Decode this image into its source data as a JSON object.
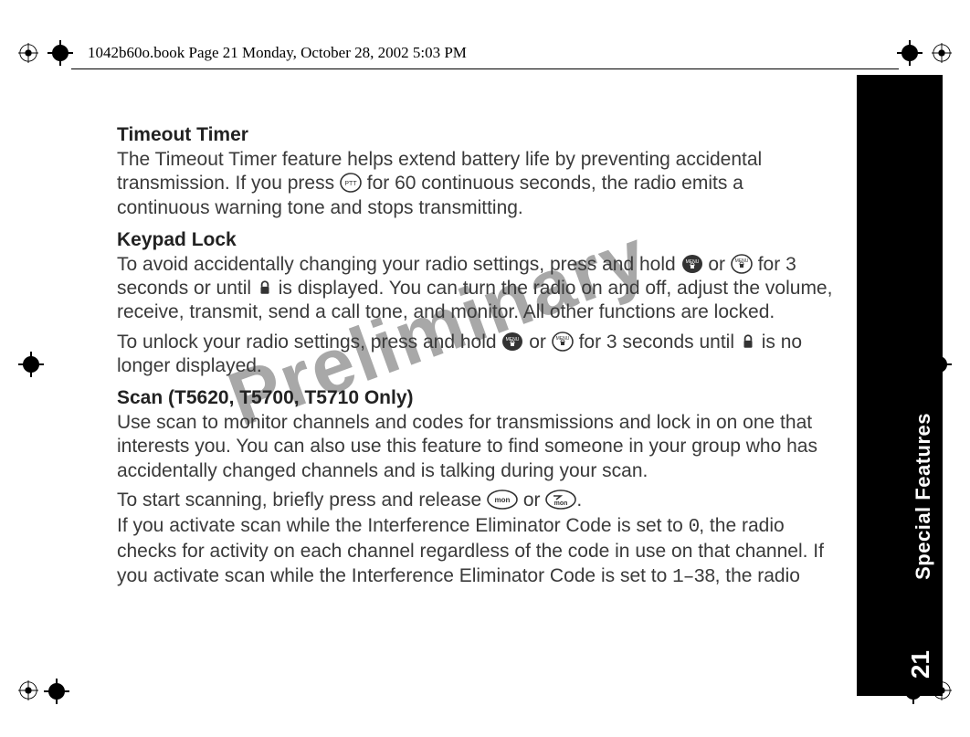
{
  "header": {
    "line": "1042b60o.book  Page 21  Monday, October 28, 2002  5:03 PM"
  },
  "watermark": "Preliminary",
  "sidebar": {
    "label": "Special Features",
    "page_number": "21"
  },
  "sections": {
    "timeout": {
      "heading": "Timeout Timer",
      "p1a": "The Timeout Timer feature helps extend battery life by preventing accidental transmission. If you press ",
      "p1b": " for 60 continuous seconds, the radio emits a continuous warning tone and stops transmitting."
    },
    "keypad": {
      "heading": "Keypad Lock",
      "p1a": "To avoid accidentally changing your radio settings, press and hold ",
      "p1b": " or ",
      "p1c": " for 3 seconds or until ",
      "p1d": " is displayed. You can turn the radio on and off, adjust the volume, receive, transmit, send a call tone, and monitor.  All other functions are locked.",
      "p2a": "To unlock your radio settings, press and hold ",
      "p2b": " or ",
      "p2c": "  for 3 seconds until ",
      "p2d": " is no longer displayed."
    },
    "scan": {
      "heading": "Scan (T5620, T5700, T5710 Only)",
      "p1": "Use scan to monitor channels and codes for transmissions and lock in on one that interests you. You can also use this feature to find someone in your group who has accidentally changed channels and is talking during your scan.",
      "p2a": "To start scanning, briefly press and release ",
      "p2b": "  or  ",
      "p2c": ".",
      "p3a": "If you activate scan while the Interference Eliminator Code is set to ",
      "p3_code0": "0",
      "p3b": ", the radio checks for activity on each channel regardless of the code in use on that channel. If you activate scan while the Interference Eliminator Code is set to ",
      "p3_codes": "1–38",
      "p3c": ", the radio"
    }
  },
  "icons": {
    "ptt": "PTT",
    "menu_lock": "MENU",
    "lock": "lock",
    "mon": "mon",
    "scan_mon": "mon"
  }
}
